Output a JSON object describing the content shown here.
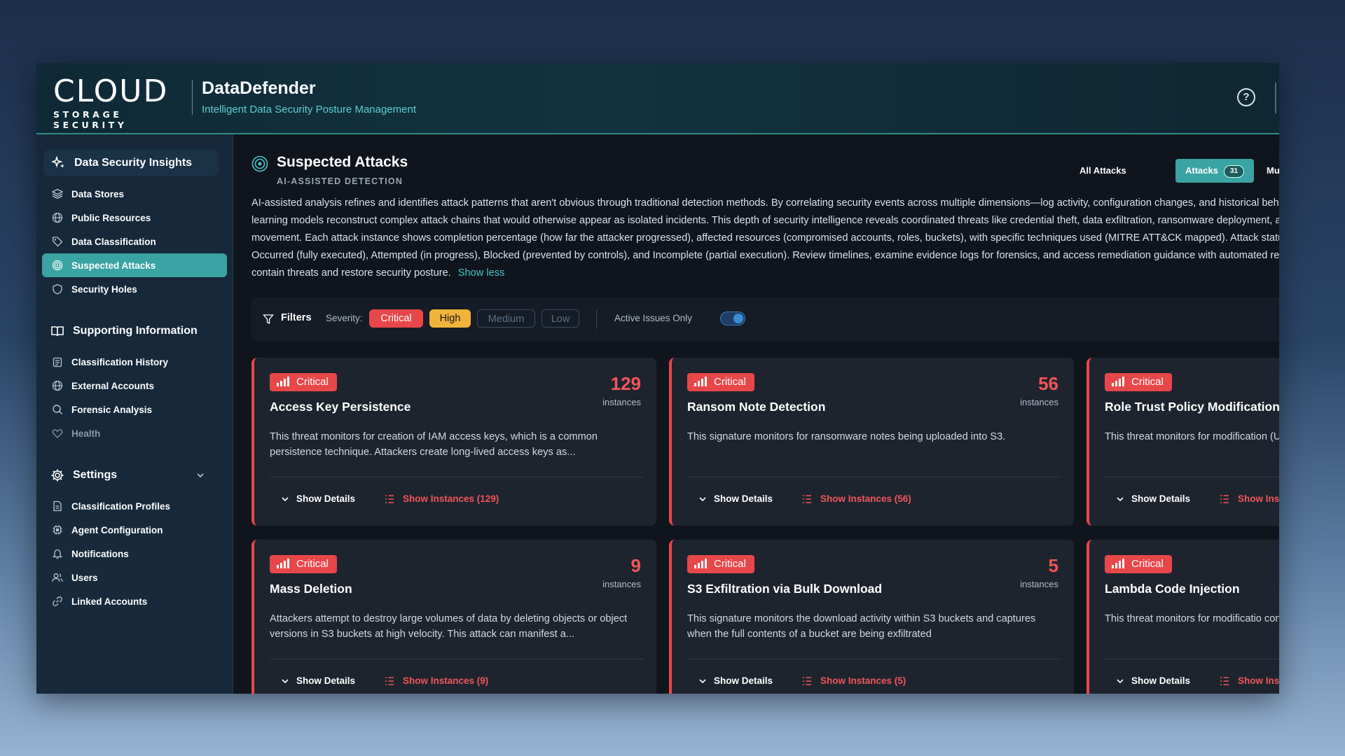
{
  "header": {
    "logo_word": "CLOUD",
    "logo_sub": "STORAGE SECURITY",
    "app_name": "DataDefender",
    "tagline": "Intelligent Data Security Posture Management"
  },
  "sidebar": {
    "insights": {
      "title": "Data Security Insights",
      "items": [
        {
          "label": "Data Stores",
          "icon": "layers-icon"
        },
        {
          "label": "Public Resources",
          "icon": "globe-icon"
        },
        {
          "label": "Data Classification",
          "icon": "tag-icon"
        },
        {
          "label": "Suspected Attacks",
          "icon": "target-icon",
          "active": true
        },
        {
          "label": "Security Holes",
          "icon": "shield-icon"
        }
      ]
    },
    "supporting": {
      "title": "Supporting Information",
      "items": [
        {
          "label": "Classification History",
          "icon": "clipboard-icon"
        },
        {
          "label": "External Accounts",
          "icon": "globe-icon"
        },
        {
          "label": "Forensic Analysis",
          "icon": "search-icon"
        },
        {
          "label": "Health",
          "icon": "heart-icon",
          "dimmed": true
        }
      ]
    },
    "settings": {
      "title": "Settings",
      "items": [
        {
          "label": "Classification Profiles",
          "icon": "file-icon"
        },
        {
          "label": "Agent Configuration",
          "icon": "cpu-icon"
        },
        {
          "label": "Notifications",
          "icon": "bell-icon"
        },
        {
          "label": "Users",
          "icon": "users-icon"
        },
        {
          "label": "Linked Accounts",
          "icon": "link-icon"
        }
      ]
    }
  },
  "main": {
    "title": "Suspected Attacks",
    "subtitle": "AI-ASSISTED DETECTION",
    "tabs": [
      {
        "label": "All Attacks"
      },
      {
        "label": "Attacks",
        "badge": "31",
        "active": true
      },
      {
        "label": "Multi-Stag"
      }
    ],
    "description": "AI-assisted analysis refines and identifies attack patterns that aren't obvious through traditional detection methods. By correlating security events across multiple dimensions—log activity, configuration changes, and historical behavior—machine learning models reconstruct complex attack chains that would otherwise appear as isolated incidents. This depth of security intelligence reveals coordinated threats like credential theft, data exfiltration, ransomware deployment, and lateral movement. Each attack instance shows completion percentage (how far the attacker progressed), affected resources (compromised accounts, roles, buckets), with specific techniques used (MITRE ATT&CK mapped). Attack statuses include: Occurred (fully executed), Attempted (in progress), Blocked (prevented by controls), and Incomplete (partial execution). Review timelines, examine evidence logs for forensics, and access remediation guidance with automated response scripts to contain threats and restore security posture.",
    "show_less": "Show less",
    "filters": {
      "label": "Filters",
      "severity_label": "Severity:",
      "chips": [
        "Critical",
        "High",
        "Medium",
        "Low"
      ],
      "active_label": "Active Issues Only"
    },
    "card_labels": {
      "unit": "instances",
      "show_details": "Show Details"
    },
    "cards": [
      {
        "severity": "Critical",
        "title": "Access Key Persistence",
        "count": "129",
        "description": "This threat monitors for creation of IAM access keys, which is a common persistence technique. Attackers create long-lived access keys as...",
        "instances_label": "Show Instances (129)"
      },
      {
        "severity": "Critical",
        "title": "Ransom Note Detection",
        "count": "56",
        "description": "This signature monitors for ransomware notes being uploaded into S3.",
        "instances_label": "Show Instances (56)"
      },
      {
        "severity": "Critical",
        "title": "Role Trust Policy Modification",
        "count": "",
        "description": "This threat monitors for modification (UpdateAssumeRolePolicy). Attacke",
        "instances_label": "Show Inst"
      },
      {
        "severity": "Critical",
        "title": "Mass Deletion",
        "count": "9",
        "description": "Attackers attempt to destroy large volumes of data by deleting objects or object versions in S3 buckets at high velocity. This attack can manifest a...",
        "instances_label": "Show Instances (9)"
      },
      {
        "severity": "Critical",
        "title": "S3 Exfiltration via Bulk Download",
        "count": "5",
        "description": "This signature monitors the download activity within S3 buckets and captures when the full contents of a bucket are being exfiltrated",
        "instances_label": "Show Instances (5)"
      },
      {
        "severity": "Critical",
        "title": "Lambda Code Injection",
        "count": "",
        "description": "This threat monitors for modificatio configuration. Attackers who compr",
        "instances_label": "Show Inst"
      }
    ]
  },
  "colors": {
    "accent": "#3aa3a3",
    "critical": "#e8474a",
    "high": "#f1b43a",
    "link": "#49c5c8"
  }
}
